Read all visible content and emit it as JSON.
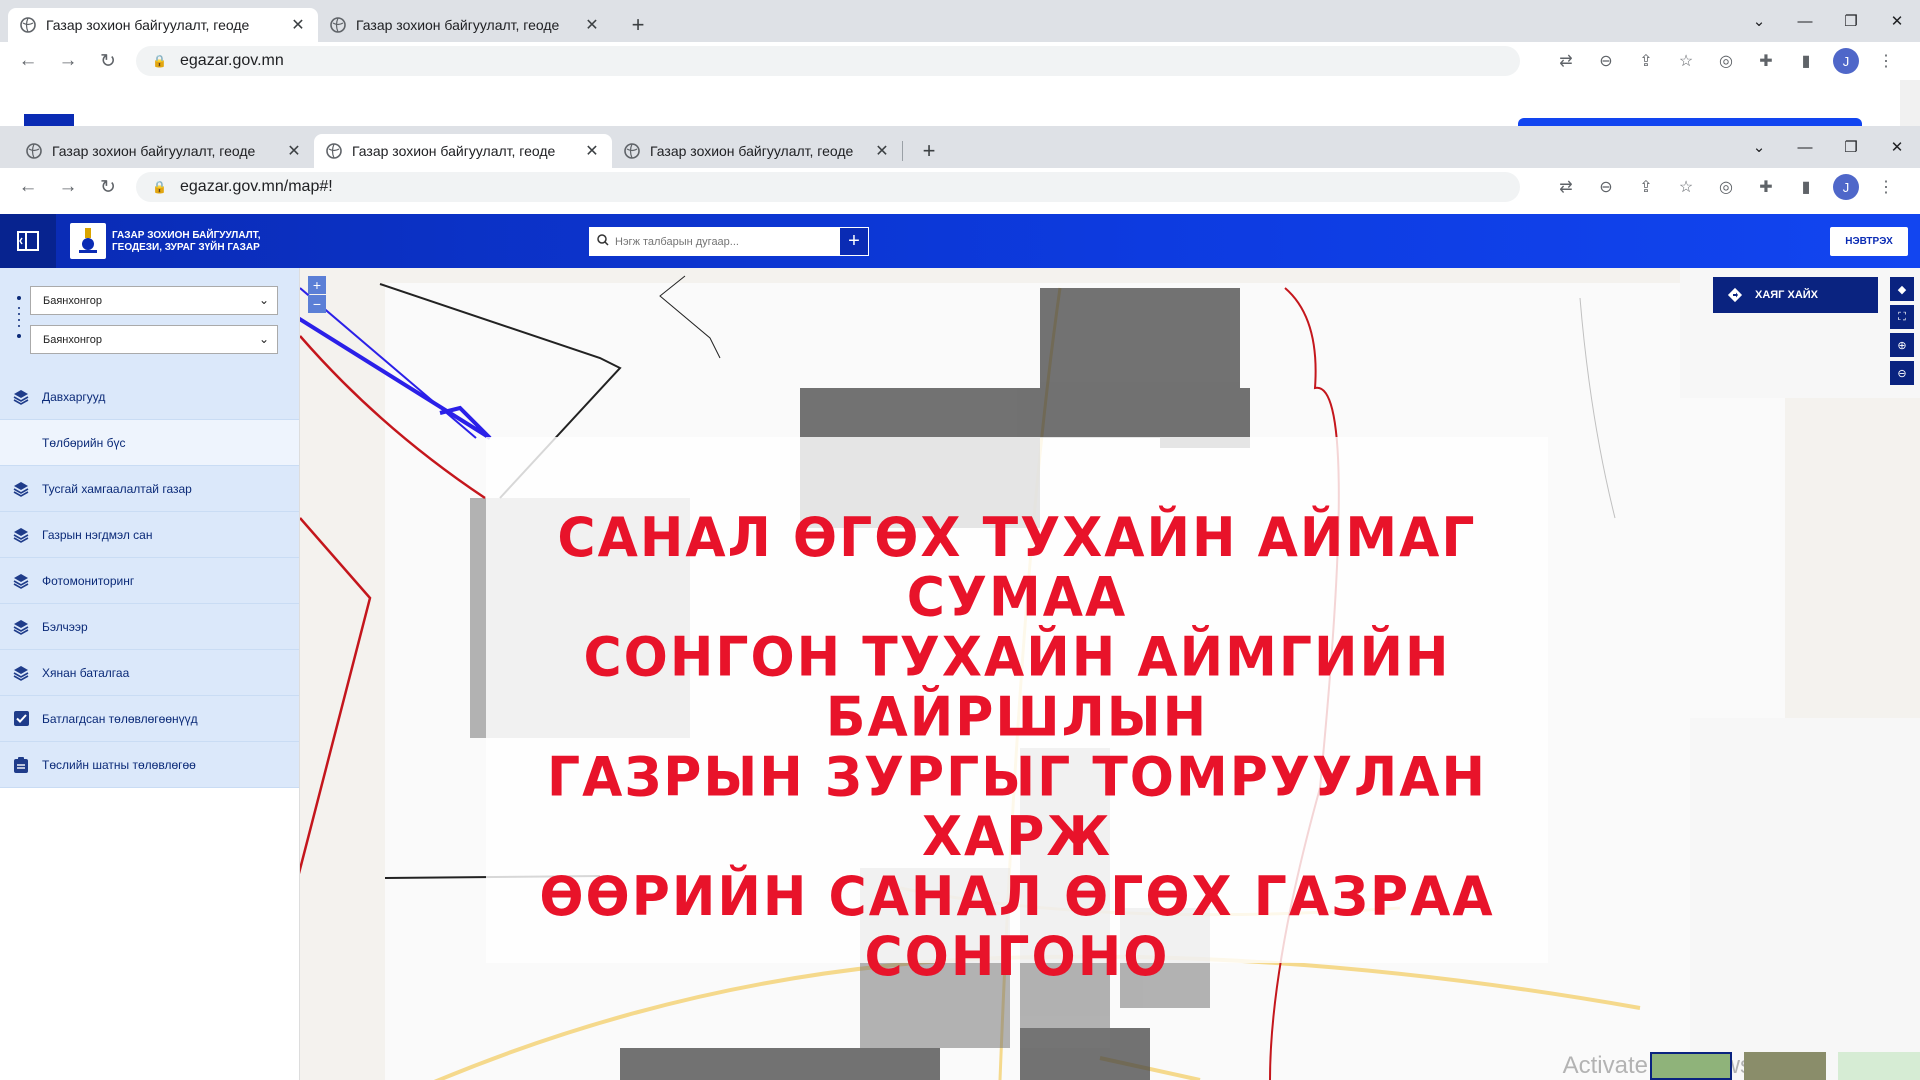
{
  "browser_back": {
    "tabs": [
      {
        "title": "Газар зохион байгуулалт, геоде"
      },
      {
        "title": "Газар зохион байгуулалт, геоде"
      }
    ],
    "url": "egazar.gov.mn"
  },
  "browser_front": {
    "tabs": [
      {
        "title": "Газар зохион байгуулалт, геоде"
      },
      {
        "title": "Газар зохион байгуулалт, геоде"
      },
      {
        "title": "Газар зохион байгуулалт, геоде"
      }
    ],
    "url": "egazar.gov.mn/map#!",
    "avatar": "J"
  },
  "app": {
    "logo_text": "ГАЗАР ЗОХИОН БАЙГУУЛАЛТ, ГЕОДЕЗИ, ЗУРАГ ЗҮЙН ГАЗАР",
    "search_placeholder": "Нэгж талбарын дугаар...",
    "search_plus": "+",
    "login": "НЭВТРЭХ"
  },
  "sidebar": {
    "select_1": "Баянхонгор",
    "select_2": "Баянхонгор",
    "items": [
      {
        "label": "Давхаргууд"
      },
      {
        "label": "Төлбөрийн бүс"
      },
      {
        "label": "Тусгай хамгаалалтай газар"
      },
      {
        "label": "Газрын нэгдмэл сан"
      },
      {
        "label": "Фотомониторинг"
      },
      {
        "label": "Бэлчээр"
      },
      {
        "label": "Хянан баталгаа"
      },
      {
        "label": "Батлагдсан төлөвлөгөөнүүд"
      },
      {
        "label": "Төслийн шатны төлөвлөгөө"
      }
    ]
  },
  "map": {
    "address_search": "ХАЯГ ХАЙХ",
    "zoom_in": "+",
    "zoom_out": "−",
    "overlay_lines": [
      "Санал өгөх тухайн аймаг сумаа",
      "сонгон тухайн аймгийн байршлын",
      "газрын зургыг томруулан харж",
      "өөрийн санал өгөх газраа сонгоно"
    ],
    "watermark": "Activate Windows"
  }
}
